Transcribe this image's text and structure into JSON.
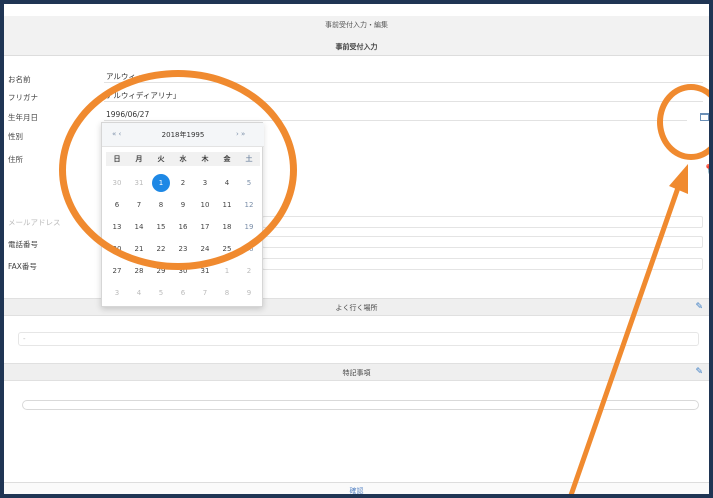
{
  "header": {
    "title": "事前受付入力・編集",
    "subtitle": "事前受付入力"
  },
  "form": {
    "fields": [
      {
        "label": "お名前",
        "value": "アルウィ・・・・"
      },
      {
        "label": "フリガナ",
        "value": "アルウィディアリナ」"
      },
      {
        "label": "生年月日",
        "value": "1996/06/27"
      },
      {
        "label": "性別",
        "value": ""
      },
      {
        "label": "住所",
        "value": ""
      },
      {
        "label": "メールアドレス",
        "value": ""
      },
      {
        "label": "電話番号",
        "value": ""
      },
      {
        "label": "FAX番号",
        "value": ""
      }
    ]
  },
  "calendar": {
    "prev_label": "« ‹",
    "next_label": "› »",
    "title": "2018年1995",
    "weekdays": [
      "日",
      "月",
      "火",
      "水",
      "木",
      "金",
      "土"
    ],
    "weeks": [
      [
        "30",
        "31",
        "1",
        "2",
        "3",
        "4",
        "5"
      ],
      [
        "6",
        "7",
        "8",
        "9",
        "10",
        "11",
        "12"
      ],
      [
        "13",
        "14",
        "15",
        "16",
        "17",
        "18",
        "19"
      ],
      [
        "20",
        "21",
        "22",
        "23",
        "24",
        "25",
        "26"
      ],
      [
        "27",
        "28",
        "29",
        "30",
        "31",
        "1",
        "2"
      ],
      [
        "3",
        "4",
        "5",
        "6",
        "7",
        "8",
        "9"
      ]
    ],
    "selected_day": "1"
  },
  "sections": {
    "frequent_place": {
      "title": "よく行く場所",
      "field_value": "-"
    },
    "remarks": {
      "title": "特記事項"
    }
  },
  "footer": {
    "submit_label": "確認"
  },
  "icons": {
    "calendar": "calendar-icon",
    "pin": "map-pin-icon",
    "edit": "pencil-icon"
  },
  "colors": {
    "frame": "#1f3554",
    "annotation": "#f08a2f",
    "selected": "#1e88e5",
    "link": "#5b87c5"
  }
}
